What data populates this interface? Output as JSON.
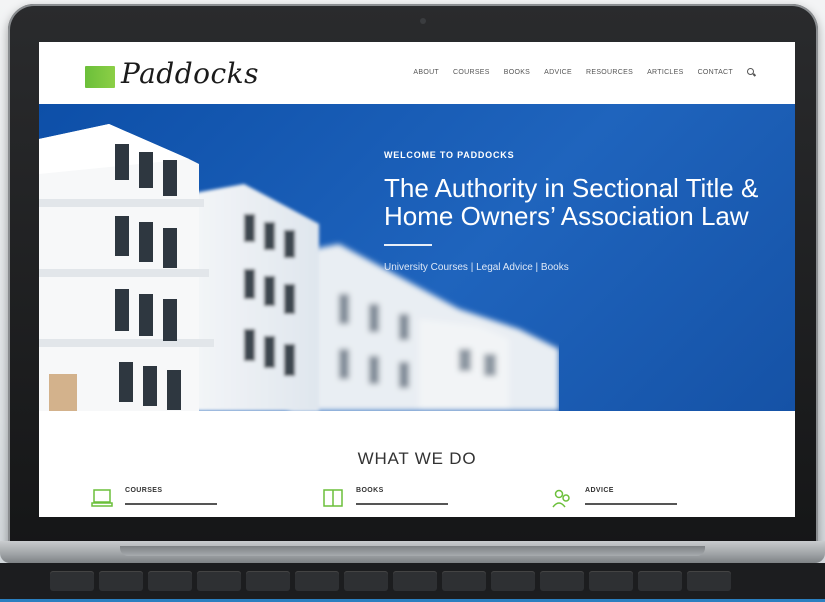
{
  "brand": {
    "name": "Paddocks",
    "accent": "#6bbf3a",
    "hero_blue": "#1a5db6"
  },
  "nav": {
    "items": [
      "ABOUT",
      "COURSES",
      "BOOKS",
      "ADVICE",
      "RESOURCES",
      "ARTICLES",
      "CONTACT"
    ],
    "search_icon": "search-icon"
  },
  "hero": {
    "kicker": "WELCOME TO PADDOCKS",
    "title_line1": "The Authority in Sectional Title &",
    "title_line2": "Home Owners’ Association Law",
    "links": "University Courses | Legal Advice | Books"
  },
  "what_we_do": {
    "title": "WHAT WE DO",
    "services": [
      {
        "label": "COURSES",
        "icon": "laptop-icon"
      },
      {
        "label": "BOOKS",
        "icon": "book-icon"
      },
      {
        "label": "ADVICE",
        "icon": "people-icon"
      }
    ]
  }
}
